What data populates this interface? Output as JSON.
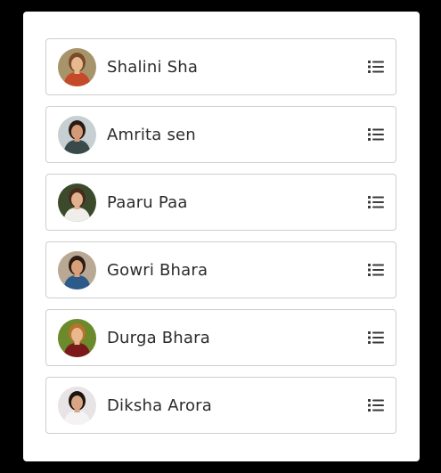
{
  "contacts": [
    {
      "name": "Shalini Sha",
      "avatar_bg": "#a8946a",
      "avatar_fg": "#7a4a2a",
      "avatar_skin": "#e6b98f",
      "avatar_accent": "#c54a2a"
    },
    {
      "name": "Amrita sen",
      "avatar_bg": "#c7cfd2",
      "avatar_fg": "#2a1a14",
      "avatar_skin": "#d49a76",
      "avatar_accent": "#3a4a4a"
    },
    {
      "name": "Paaru Paa",
      "avatar_bg": "#3c4a2c",
      "avatar_fg": "#4a2a1c",
      "avatar_skin": "#e0b290",
      "avatar_accent": "#f0eeea"
    },
    {
      "name": "Gowri Bhara",
      "avatar_bg": "#b8a894",
      "avatar_fg": "#2c1c12",
      "avatar_skin": "#d8a07a",
      "avatar_accent": "#2c5a8a"
    },
    {
      "name": "Durga Bhara",
      "avatar_bg": "#6a8a2c",
      "avatar_fg": "#b8722c",
      "avatar_skin": "#eab88e",
      "avatar_accent": "#7a1a1a"
    },
    {
      "name": "Diksha Arora",
      "avatar_bg": "#e8e4e6",
      "avatar_fg": "#1c1410",
      "avatar_skin": "#d8a684",
      "avatar_accent": "#f4f2f2"
    }
  ],
  "icons": {
    "drag_handle": "list-icon"
  },
  "colors": {
    "background": "#000000",
    "panel": "#ffffff",
    "border": "#cfcfcf",
    "text": "#2b2b2b",
    "icon": "#3a3a3a"
  }
}
